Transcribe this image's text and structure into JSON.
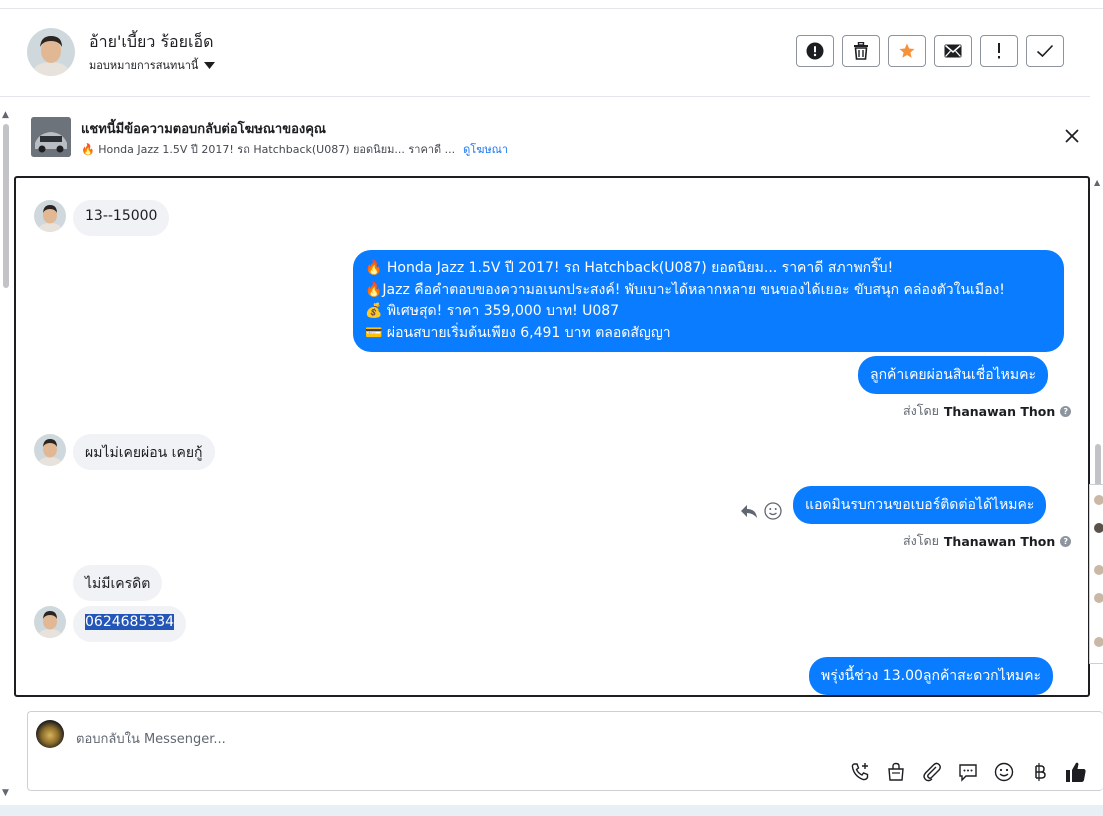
{
  "header": {
    "contact_name": "อ้าย'เบี้ยว ร้อยเอ็ด",
    "assign_label": "มอบหมายการสนทนานี้",
    "actions": [
      {
        "name": "spam-button",
        "icon": "exclamation-circle-icon"
      },
      {
        "name": "delete-button",
        "icon": "trash-icon"
      },
      {
        "name": "star-button",
        "icon": "star-icon",
        "color": "#f7923b"
      },
      {
        "name": "mark-unread-button",
        "icon": "envelope-icon"
      },
      {
        "name": "follow-up-button",
        "icon": "exclamation-icon"
      },
      {
        "name": "mark-done-button",
        "icon": "check-icon"
      }
    ]
  },
  "ad_banner": {
    "title": "แชทนี้มีข้อความตอบกลับต่อโฆษณาของคุณ",
    "subtitle": "🔥 Honda Jazz 1.5V ปี 2017! รถ Hatchback(U087) ยอดนิยม... ราคาดี ...",
    "link": "ดูโฆษณา"
  },
  "messages": {
    "m1": "13--15000",
    "m2_lines": [
      "🔥 Honda Jazz 1.5V ปี 2017! รถ Hatchback(U087) ยอดนิยม... ราคาดี สภาพกริ๊บ!",
      "🔥Jazz คือคำตอบของความอเนกประสงค์! พับเบาะได้หลากหลาย ขนของได้เยอะ ขับสนุก คล่องตัวในเมือง!",
      "💰 พิเศษสุด! ราคา 359,000 บาท! U087",
      "💳 ผ่อนสบายเริ่มต้นเพียง 6,491 บาท ตลอดสัญญา"
    ],
    "m3": "ลูกค้าเคยผ่อนสินเชื่อไหมคะ",
    "sent_by_label": "ส่งโดย",
    "sender_name": "Thanawan Thon",
    "m4": "ผมไม่เคยผ่อน เคยกู้",
    "m5": "แอดมินรบกวนขอเบอร์ติดต่อได้ไหมคะ",
    "m6": "ไม่มีเครดิต",
    "m7": "0624685334",
    "m8": "พรุ่งนี้ช่วง 13.00ลูกค้าสะดวกไหมคะ"
  },
  "composer": {
    "placeholder": "ตอบกลับใน Messenger...",
    "tools": [
      "phone-add-icon",
      "shopping-bag-icon",
      "paperclip-icon",
      "saved-reply-icon",
      "emoji-icon",
      "baht-icon",
      "thumbs-up-icon"
    ]
  },
  "colors": {
    "outgoing_bubble": "#0a7cff",
    "incoming_bubble": "#f0f2f5",
    "link": "#1877f2"
  }
}
